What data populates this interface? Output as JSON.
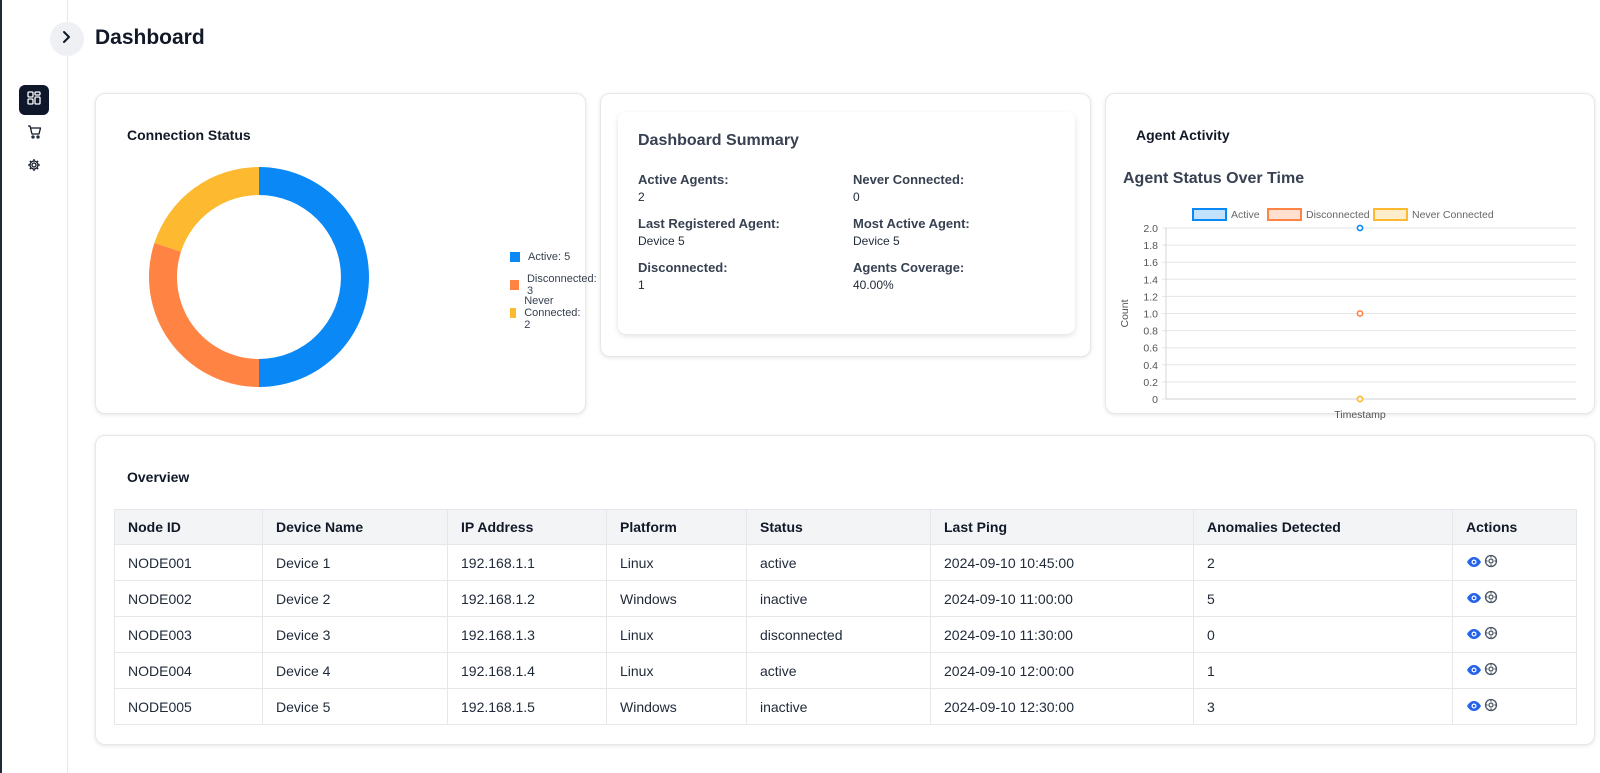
{
  "header": {
    "title": "Dashboard"
  },
  "sidebar": {
    "items": [
      {
        "icon": "dashboard-icon",
        "active": true
      },
      {
        "icon": "cart-icon",
        "active": false
      },
      {
        "icon": "gear-icon",
        "active": false
      }
    ]
  },
  "connection_status": {
    "title": "Connection Status",
    "legend": [
      "Active: 5",
      "Disconnected: 3",
      "Never Connected: 2"
    ]
  },
  "summary": {
    "title": "Dashboard Summary",
    "active_agents_label": "Active Agents:",
    "active_agents": "2",
    "never_connected_label": "Never Connected:",
    "never_connected": "0",
    "last_registered_label": "Last Registered Agent:",
    "last_registered": "Device 5",
    "most_active_label": "Most Active Agent:",
    "most_active": "Device 5",
    "disconnected_label": "Disconnected:",
    "disconnected": "1",
    "coverage_label": "Agents Coverage:",
    "coverage": "40.00%"
  },
  "agent_activity": {
    "title": "Agent Activity",
    "chart_title": "Agent Status Over Time"
  },
  "overview": {
    "title": "Overview",
    "columns": [
      "Node ID",
      "Device Name",
      "IP Address",
      "Platform",
      "Status",
      "Last Ping",
      "Anomalies Detected",
      "Actions"
    ],
    "rows": [
      {
        "node": "NODE001",
        "device": "Device 1",
        "ip": "192.168.1.1",
        "platform": "Linux",
        "status": "active",
        "ping": "2024-09-10 10:45:00",
        "anomalies": "2"
      },
      {
        "node": "NODE002",
        "device": "Device 2",
        "ip": "192.168.1.2",
        "platform": "Windows",
        "status": "inactive",
        "ping": "2024-09-10 11:00:00",
        "anomalies": "5"
      },
      {
        "node": "NODE003",
        "device": "Device 3",
        "ip": "192.168.1.3",
        "platform": "Linux",
        "status": "disconnected",
        "ping": "2024-09-10 11:30:00",
        "anomalies": "0"
      },
      {
        "node": "NODE004",
        "device": "Device 4",
        "ip": "192.168.1.4",
        "platform": "Linux",
        "status": "active",
        "ping": "2024-09-10 12:00:00",
        "anomalies": "1"
      },
      {
        "node": "NODE005",
        "device": "Device 5",
        "ip": "192.168.1.5",
        "platform": "Windows",
        "status": "inactive",
        "ping": "2024-09-10 12:30:00",
        "anomalies": "3"
      }
    ]
  },
  "colors": {
    "active": "#0a88f5",
    "disconnected": "#ff8444",
    "never": "#fdb92f",
    "accent_dark": "#0f172a"
  },
  "chart_data": [
    {
      "type": "pie",
      "donut": true,
      "title": "",
      "categories": [
        "Active",
        "Disconnected",
        "Never Connected"
      ],
      "values": [
        5,
        3,
        2
      ],
      "legend": "right"
    },
    {
      "type": "scatter",
      "title": "Agent Status Over Time",
      "xlabel": "Timestamp",
      "ylabel": "Count",
      "ylim": [
        0,
        2
      ],
      "yticks": [
        "2.0",
        "1.8",
        "1.6",
        "1.4",
        "1.2",
        "1.0",
        "0.8",
        "0.6",
        "0.4",
        "0.2",
        "0"
      ],
      "legend": "top",
      "grid": true,
      "series": [
        {
          "name": "Active",
          "values": [
            2
          ]
        },
        {
          "name": "Disconnected",
          "values": [
            1
          ]
        },
        {
          "name": "Never Connected",
          "values": [
            0
          ]
        }
      ]
    }
  ]
}
